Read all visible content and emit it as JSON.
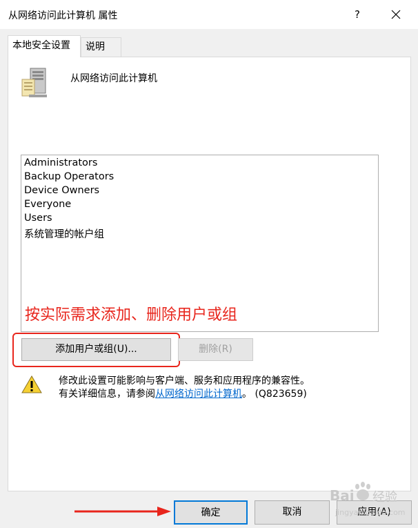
{
  "window": {
    "title": "从网络访问此计算机 属性",
    "help_label": "?"
  },
  "tabs": [
    {
      "label": "本地安全设置"
    },
    {
      "label": "说明"
    }
  ],
  "policy": {
    "name": "从网络访问此计算机",
    "icon": "server-icon"
  },
  "accounts": [
    "Administrators",
    "Backup Operators",
    "Device Owners",
    "Everyone",
    "Users",
    "系统管理的帐户组"
  ],
  "annotation": {
    "text": "按实际需求添加、删除用户或组",
    "color": "#e8251c"
  },
  "buttons": {
    "add": "添加用户或组(U)...",
    "remove": "删除(R)",
    "ok": "确定",
    "cancel": "取消",
    "apply": "应用(A)"
  },
  "warning": {
    "line1": "修改此设置可能影响与客户端、服务和应用程序的兼容性。",
    "line2_prefix": "有关详细信息，请参阅",
    "link": "从网络访问此计算机",
    "line2_suffix": "。 (Q823659)"
  },
  "watermark": {
    "brand": "Bai",
    "brand_suffix": "经验",
    "url": "jingyan.baidu.com"
  }
}
